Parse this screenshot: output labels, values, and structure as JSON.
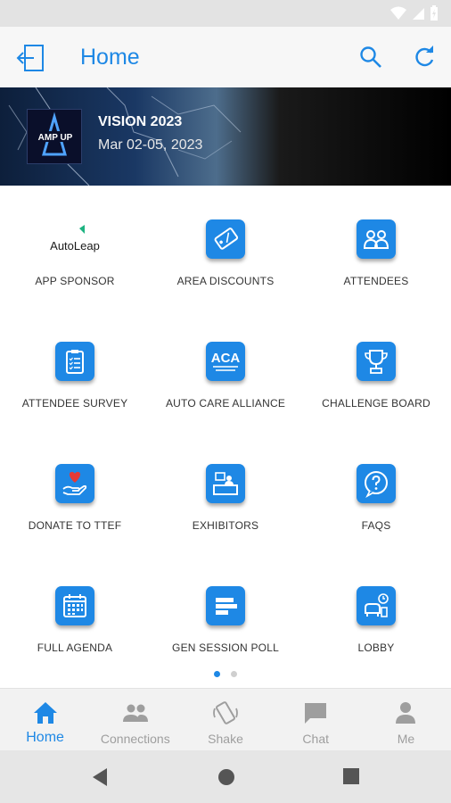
{
  "header": {
    "title": "Home"
  },
  "banner": {
    "event_name": "VISION 2023",
    "event_dates": "Mar 02-05, 2023",
    "logo_text": "AMP UP"
  },
  "tiles": [
    {
      "label": "APP SPONSOR",
      "icon": "autoleap-logo",
      "sponsor": "AutoLeap"
    },
    {
      "label": "AREA DISCOUNTS",
      "icon": "discount-tag-icon"
    },
    {
      "label": "ATTENDEES",
      "icon": "people-icon"
    },
    {
      "label": "ATTENDEE SURVEY",
      "icon": "clipboard-icon"
    },
    {
      "label": "AUTO CARE ALLIANCE",
      "icon": "aca-logo-icon",
      "badge": "ACA"
    },
    {
      "label": "CHALLENGE BOARD",
      "icon": "trophy-icon"
    },
    {
      "label": "DONATE TO TTEF",
      "icon": "heart-hand-icon"
    },
    {
      "label": "EXHIBITORS",
      "icon": "booth-icon"
    },
    {
      "label": "FAQS",
      "icon": "question-bubble-icon"
    },
    {
      "label": "FULL AGENDA",
      "icon": "calendar-icon"
    },
    {
      "label": "GEN SESSION POLL",
      "icon": "poll-icon"
    },
    {
      "label": "LOBBY",
      "icon": "lobby-icon"
    }
  ],
  "pager": {
    "pages": 2,
    "current": 1
  },
  "tabs": [
    {
      "label": "Home",
      "icon": "home-icon",
      "active": true
    },
    {
      "label": "Connections",
      "icon": "connections-icon"
    },
    {
      "label": "Shake",
      "icon": "shake-icon"
    },
    {
      "label": "Chat",
      "icon": "chat-icon"
    },
    {
      "label": "Me",
      "icon": "person-icon"
    }
  ],
  "colors": {
    "accent": "#1e88e5",
    "inactive": "#9e9e9e"
  }
}
